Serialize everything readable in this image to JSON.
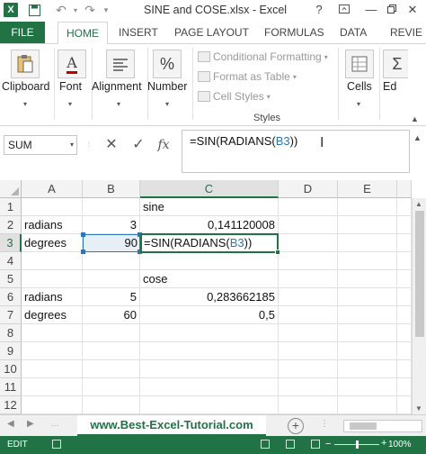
{
  "titlebar": {
    "title": "SINE and COSE.xlsx - Excel",
    "help": "?",
    "minimize": "—",
    "close": "✕"
  },
  "tabs": {
    "file": "FILE",
    "items": [
      "HOME",
      "INSERT",
      "PAGE LAYOUT",
      "FORMULAS",
      "DATA",
      "REVIE"
    ]
  },
  "ribbon": {
    "clipboard": "Clipboard",
    "font": "Font",
    "alignment": "Alignment",
    "number": "Number",
    "styles": {
      "conditional_formatting": "Conditional Formatting",
      "format_as_table": "Format as Table",
      "cell_styles": "Cell Styles",
      "label": "Styles"
    },
    "cells": "Cells",
    "editing": "Ed"
  },
  "formula_bar": {
    "name_box": "SUM",
    "formula_prefix": "=SIN(RADIANS(",
    "formula_ref": "B3",
    "formula_suffix": "))"
  },
  "sheet": {
    "columns": [
      "A",
      "B",
      "C",
      "D",
      "E"
    ],
    "rows": [
      "1",
      "2",
      "3",
      "4",
      "5",
      "6",
      "7",
      "8",
      "9",
      "10",
      "11",
      "12"
    ],
    "cells": {
      "C1": "sine",
      "A2": "radians",
      "B2": "3",
      "C2": "0,141120008",
      "A3": "degrees",
      "B3": "90",
      "C3_prefix": "=SIN(RADIANS(",
      "C3_ref": "B3",
      "C3_suffix": "))",
      "C5": "cose",
      "A6": "radians",
      "B6": "5",
      "C6": "0,283662185",
      "A7": "degrees",
      "B7": "60",
      "C7": "0,5"
    },
    "active_cell": "C3",
    "referenced_cell": "B3"
  },
  "sheet_tab": {
    "name": "www.Best-Excel-Tutorial.com"
  },
  "status_bar": {
    "mode": "EDIT",
    "zoom": "100%"
  },
  "colors": {
    "excel_green": "#217346",
    "reference_blue": "#2e75b6"
  }
}
